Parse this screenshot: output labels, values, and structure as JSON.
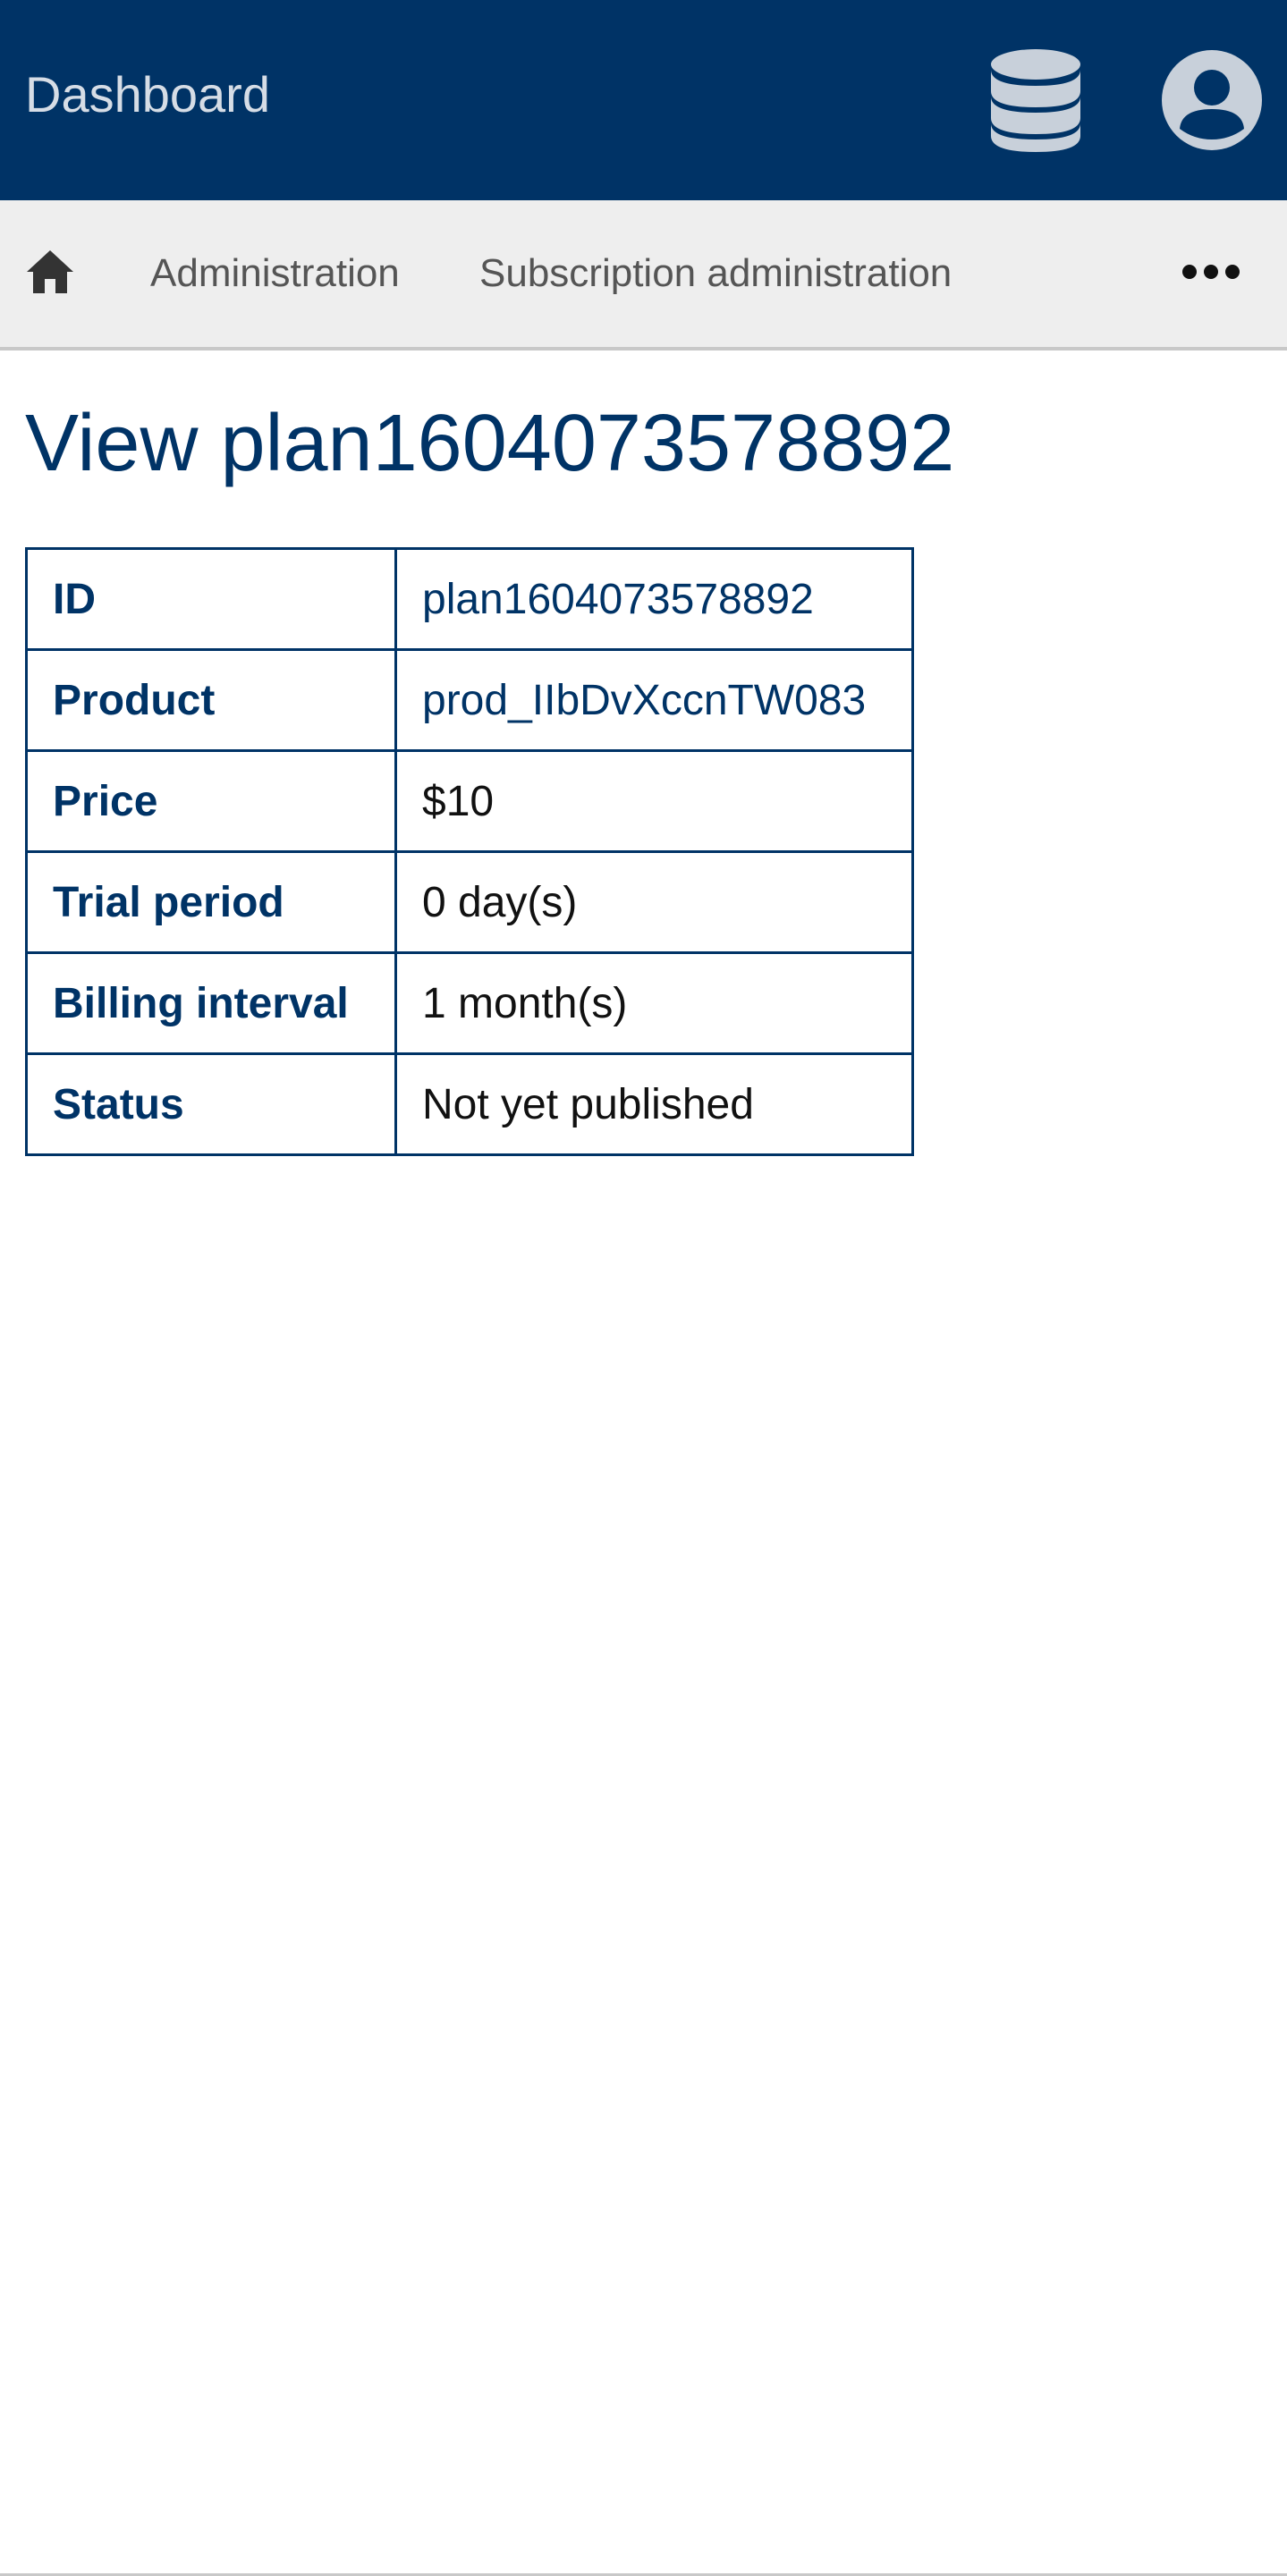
{
  "header": {
    "brand": "Dashboard",
    "icons": {
      "database": "database-icon",
      "account": "user-circle-icon"
    },
    "colors": {
      "background": "#003366",
      "icon": "#c8d0da"
    }
  },
  "breadcrumb": {
    "home_icon": "home-icon",
    "items": [
      "Administration",
      "Subscription administration"
    ],
    "more_icon": "ellipsis-icon"
  },
  "page": {
    "title": "View plan1604073578892"
  },
  "details": {
    "rows": [
      {
        "label": "ID",
        "value": "plan1604073578892"
      },
      {
        "label": "Product",
        "value": "prod_IIbDvXccnTW083"
      },
      {
        "label": "Price",
        "value": "$10"
      },
      {
        "label": "Trial period",
        "value": "0 day(s)"
      },
      {
        "label": "Billing interval",
        "value": "1 month(s)"
      },
      {
        "label": "Status",
        "value": "Not yet published"
      }
    ]
  }
}
